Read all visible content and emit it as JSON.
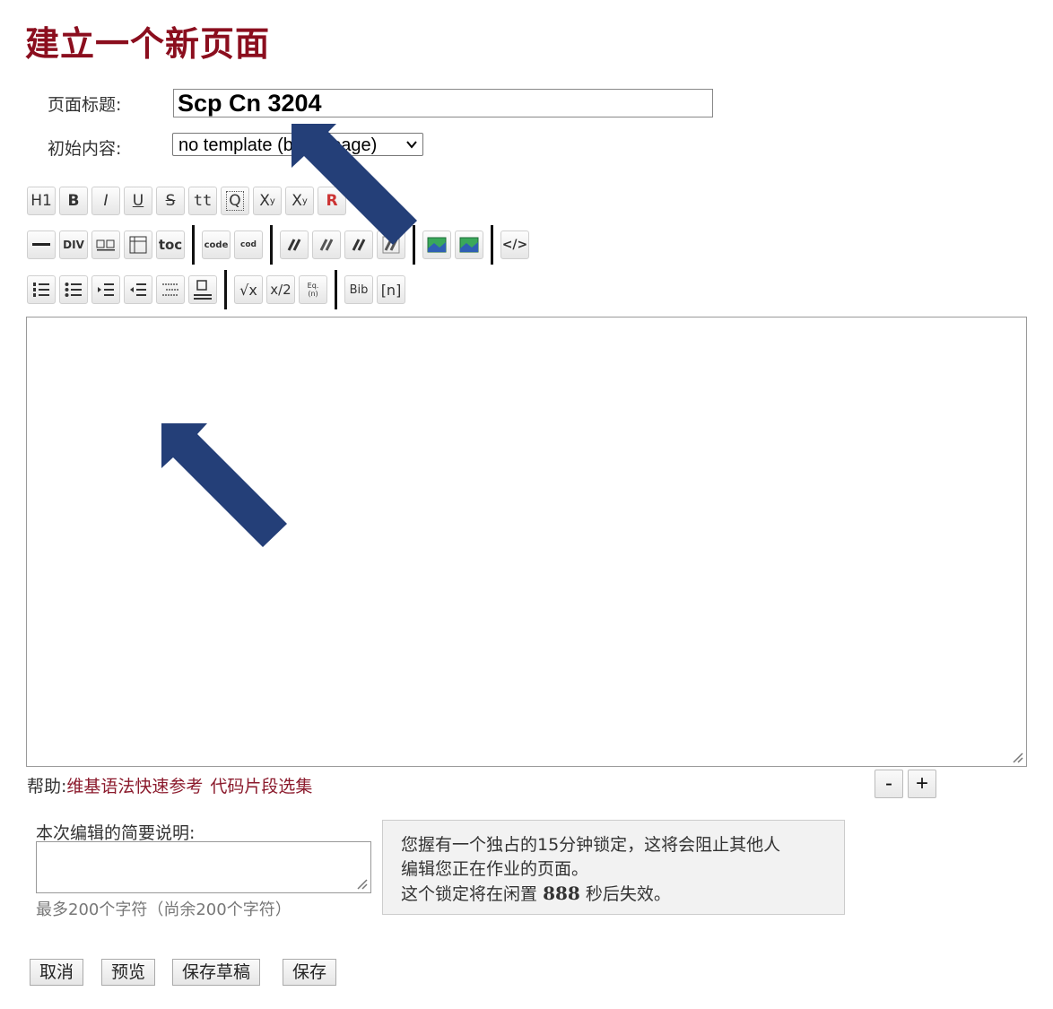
{
  "page_title": "建立一个新页面",
  "form": {
    "title_label": "页面标题:",
    "title_value": "Scp Cn 3204",
    "template_label": "初始内容:",
    "template_selected": "no template (blank page)"
  },
  "toolbar": {
    "row1": [
      "H1",
      "B",
      "I",
      "U",
      "S",
      "tt",
      "Q",
      "X",
      "X",
      "R"
    ],
    "row1_sup": "y",
    "row1_sub": "y",
    "row2_div": "DIV",
    "row2_toc": "toc",
    "row2_code": "code",
    "row2_code2": "cod",
    "row2_html": "</>",
    "row3_sqrt": "√x",
    "row3_frac": "x/2",
    "row3_eq": "Eq.",
    "row3_eq_sub": "(n)",
    "row3_bib": "Bib",
    "row3_ref": "[n]"
  },
  "help": {
    "label": "帮助:",
    "link1": "维基语法快速参考",
    "link2": "代码片段选集"
  },
  "resize": {
    "minus": "-",
    "plus": "+"
  },
  "summary": {
    "label": "本次编辑的简要说明:",
    "limit_text": "最多200个字符（尚余200个字符）"
  },
  "lock": {
    "line1": "您握有一个独占的15分钟锁定，这将会阻止其他人",
    "line2": "编辑您正在作业的页面。",
    "line3_pre": "这个锁定将在闲置",
    "seconds": "888",
    "line3_post": "秒后失效。"
  },
  "buttons": {
    "cancel": "取消",
    "preview": "预览",
    "save_draft": "保存草稿",
    "save": "保存"
  },
  "colors": {
    "title": "#8b0e1e",
    "link": "#8b1a2c",
    "arrow": "#243f78"
  }
}
